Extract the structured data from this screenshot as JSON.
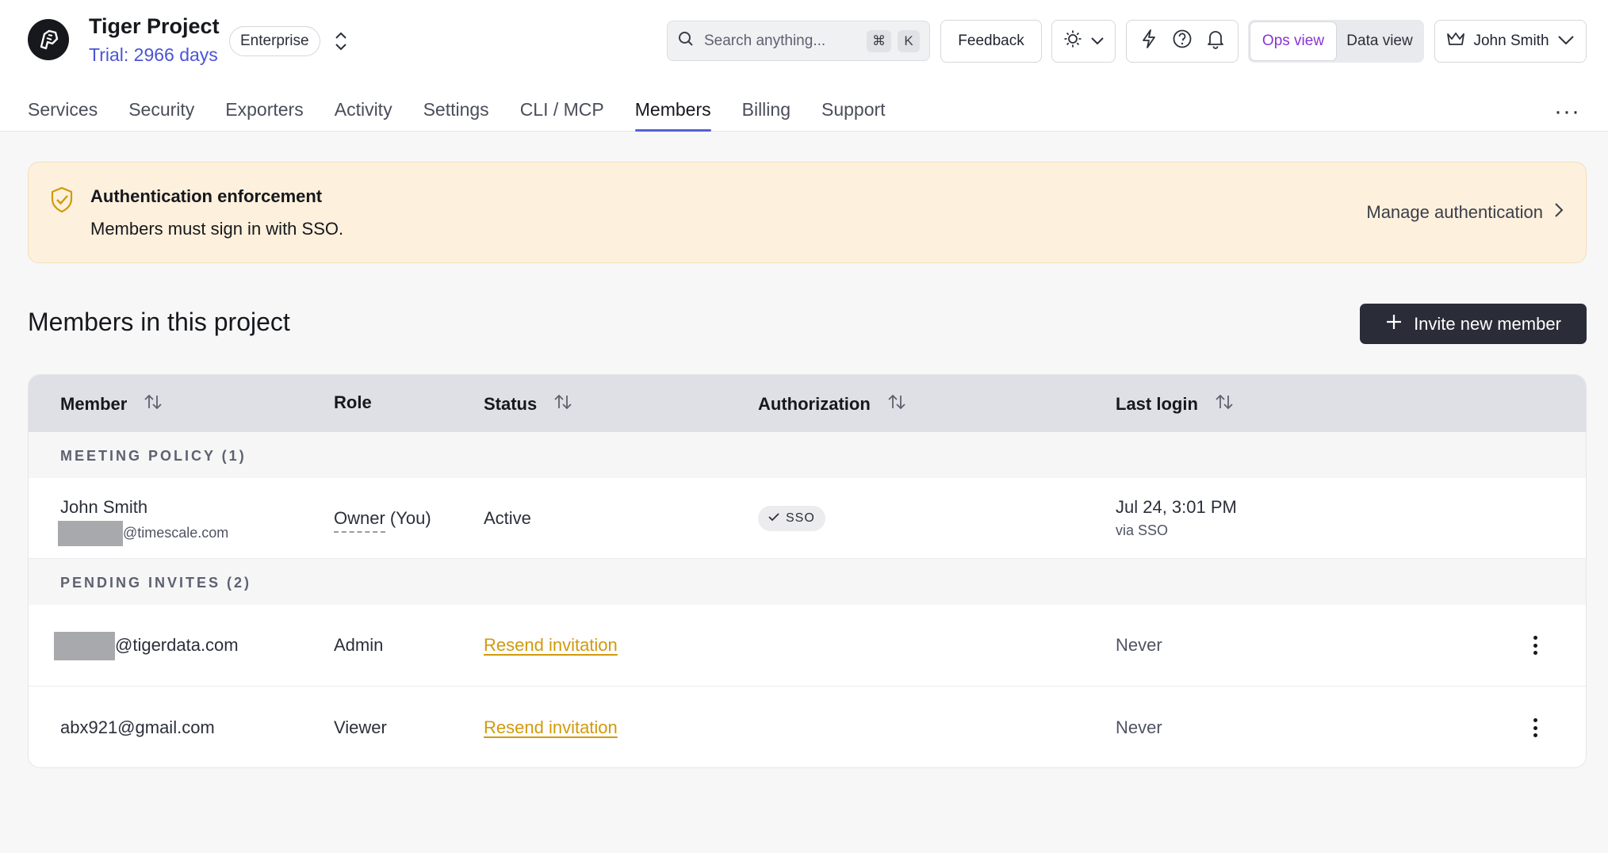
{
  "header": {
    "project_name": "Tiger Project",
    "trial_text": "Trial: 2966 days",
    "plan": "Enterprise",
    "search_placeholder": "Search anything...",
    "search_kbd_1": "⌘",
    "search_kbd_2": "K",
    "feedback_label": "Feedback",
    "view_ops": "Ops view",
    "view_data": "Data view",
    "user_name": "John Smith"
  },
  "tabs": [
    {
      "label": "Services"
    },
    {
      "label": "Security"
    },
    {
      "label": "Exporters"
    },
    {
      "label": "Activity"
    },
    {
      "label": "Settings"
    },
    {
      "label": "CLI / MCP"
    },
    {
      "label": "Members",
      "active": true
    },
    {
      "label": "Billing"
    },
    {
      "label": "Support"
    }
  ],
  "more_label": "···",
  "banner": {
    "title": "Authentication enforcement",
    "subtitle": "Members must sign in with SSO.",
    "action": "Manage authentication"
  },
  "section_title": "Members in this project",
  "invite_label": "Invite new member",
  "table": {
    "headers": {
      "member": "Member",
      "role": "Role",
      "status": "Status",
      "authorization": "Authorization",
      "last_login": "Last login"
    },
    "group_1": "MEETING POLICY  (1)",
    "group_2": "PENDING INVITES  (2)",
    "rows": [
      {
        "name": "John Smith",
        "email_domain": "@timescale.com",
        "role": "Owner",
        "role_suffix": "(You)",
        "status": "Active",
        "auth": "SSO",
        "last_login": "Jul 24, 3:01 PM",
        "last_login_sub": "via SSO"
      },
      {
        "email_domain": "@tigerdata.com",
        "role": "Admin",
        "status": "Resend invitation",
        "last_login": "Never"
      },
      {
        "email": "abx921@gmail.com",
        "role": "Viewer",
        "status": "Resend invitation",
        "last_login": "Never"
      }
    ]
  },
  "colors": {
    "accent": "#5560d6",
    "trial": "#4a55d4",
    "ops_view": "#8a33d6",
    "banner_bg": "#fdf0dc",
    "link_amber": "#d19a0b",
    "primary_button": "#2a2c38"
  },
  "icons": [
    "tiger-logo-icon",
    "chevron-up-down-icon",
    "search-icon",
    "sun-icon",
    "chevron-down-icon",
    "bolt-icon",
    "help-icon",
    "bell-icon",
    "crown-icon",
    "shield-check-icon",
    "chevron-right-icon",
    "plus-icon",
    "sort-icon",
    "check-icon",
    "kebab-icon"
  ]
}
